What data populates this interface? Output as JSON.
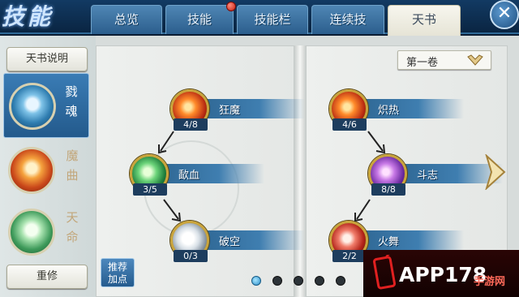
{
  "window": {
    "title": "技能",
    "close_icon": "close-icon"
  },
  "tabs": [
    {
      "label": "总览",
      "active": false,
      "badge": false
    },
    {
      "label": "技能",
      "active": false,
      "badge": true
    },
    {
      "label": "技能栏",
      "active": false,
      "badge": false
    },
    {
      "label": "连续技",
      "active": false,
      "badge": false
    },
    {
      "label": "天书",
      "active": true,
      "badge": false
    }
  ],
  "sidebar": {
    "help_label": "天书说明",
    "items": [
      {
        "label": "戮魂",
        "active": true
      },
      {
        "label": "魔曲",
        "active": false
      },
      {
        "label": "天命",
        "active": false
      }
    ],
    "reset_label": "重修"
  },
  "book": {
    "volume": "第一卷",
    "left_skills": [
      {
        "name": "狂魔",
        "count": "4/8"
      },
      {
        "name": "歃血",
        "count": "3/5"
      },
      {
        "name": "破空",
        "count": "0/3"
      }
    ],
    "right_skills": [
      {
        "name": "炽热",
        "count": "4/6"
      },
      {
        "name": "斗志",
        "count": "8/8"
      },
      {
        "name": "火舞",
        "count": "2/2"
      }
    ],
    "recommend_label": "推荐加点",
    "page_count": 5,
    "current_page": 1
  },
  "watermark": {
    "text": "APP178",
    "sub": "手游网"
  },
  "colors": {
    "accent": "#2d6490",
    "tab_active": "#f7f6ee",
    "badge_red": "#c21d10"
  }
}
